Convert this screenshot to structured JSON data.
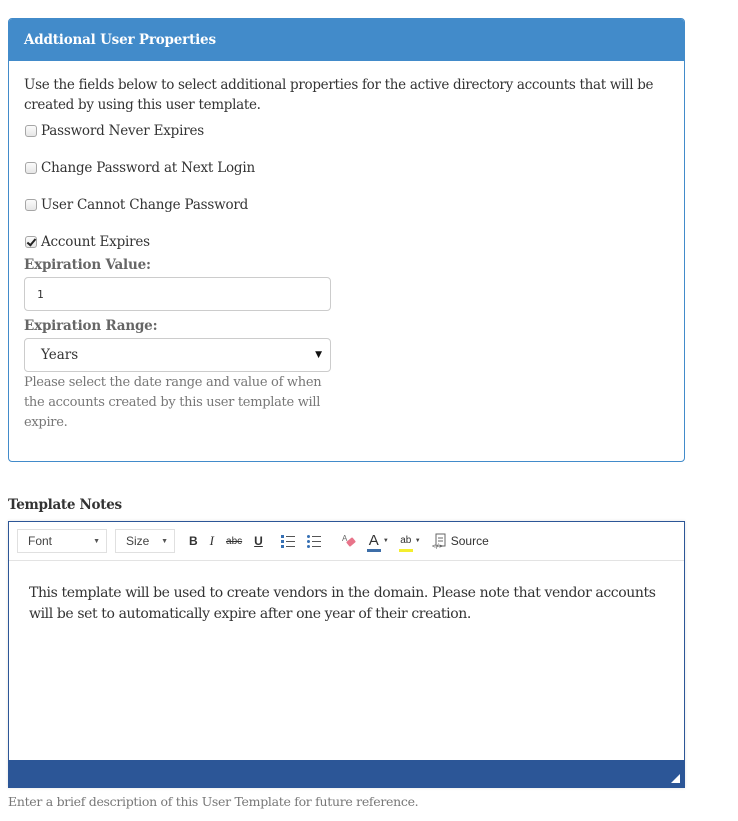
{
  "panel": {
    "title": "Addtional User Properties",
    "intro": "Use the fields below to select additional properties for the active directory accounts that will be created by using this user template.",
    "checkboxes": [
      {
        "label": "Password Never Expires",
        "checked": false
      },
      {
        "label": "Change Password at Next Login",
        "checked": false
      },
      {
        "label": "User Cannot Change Password",
        "checked": false
      },
      {
        "label": "Account Expires",
        "checked": true
      }
    ],
    "expiration_value_label": "Expiration Value:",
    "expiration_value": "1",
    "expiration_range_label": "Expiration Range:",
    "expiration_range_selected": "Years",
    "expiration_help": "Please select the date range and value of when the accounts created by this user template will expire."
  },
  "notes": {
    "label": "Template Notes",
    "toolbar": {
      "font_label": "Font",
      "size_label": "Size",
      "bold": "B",
      "italic": "I",
      "strike": "abc",
      "underline": "U",
      "source_label": "Source"
    },
    "content": "This template will be used to create vendors in the domain. Please note that vendor accounts will be set to automatically expire after one year of their creation.",
    "help": "Enter a brief description of this User Template for future reference."
  },
  "colors": {
    "panel_primary": "#428bca",
    "editor_dark": "#2c5697",
    "text_color_bar": "#3d6ea8",
    "highlight_color_bar": "#f4ee2e"
  }
}
